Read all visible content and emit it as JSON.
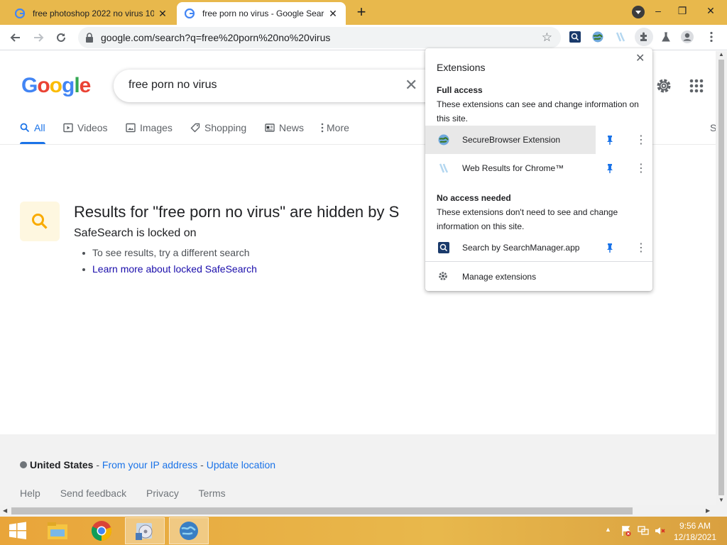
{
  "browser": {
    "tabs": [
      {
        "title": "free photoshop 2022 no virus 10",
        "active": false
      },
      {
        "title": "free porn no virus - Google Searc",
        "active": true
      }
    ],
    "url": "google.com/search?q=free%20porn%20no%20virus",
    "window_controls": {
      "minimize": "–",
      "restore": "❐",
      "close": "✕"
    },
    "toolbar_icons": [
      "back-icon",
      "forward-icon",
      "reload-icon",
      "lock-icon",
      "star-icon",
      "searchmanager-icon",
      "securebrowser-icon",
      "webresults-icon",
      "extensions-puzzle-icon",
      "lab-icon",
      "profile-icon",
      "menu-icon"
    ]
  },
  "google": {
    "logo": "Google",
    "query": "free porn no virus",
    "tabs": [
      {
        "label": "All",
        "icon": "search-icon",
        "selected": true
      },
      {
        "label": "Videos",
        "icon": "video-icon"
      },
      {
        "label": "Images",
        "icon": "image-icon"
      },
      {
        "label": "Shopping",
        "icon": "tag-icon"
      },
      {
        "label": "News",
        "icon": "news-icon"
      },
      {
        "label": "More",
        "icon": "kebab-icon"
      }
    ],
    "tools_partial": "S",
    "safesearch": {
      "title": "Results for \"free porn no virus\" are hidden by S",
      "subtitle": "SafeSearch is locked on",
      "bullets": [
        {
          "text": "To see results, try a different search",
          "link": false
        },
        {
          "text": "Learn more about locked SafeSearch",
          "link": true
        }
      ]
    },
    "footer": {
      "country": "United States",
      "sep1": " - ",
      "from_ip": "From your IP address",
      "sep2": " - ",
      "update": "Update location",
      "links": [
        "Help",
        "Send feedback",
        "Privacy",
        "Terms"
      ]
    }
  },
  "extensions_popup": {
    "title": "Extensions",
    "full_access": {
      "heading": "Full access",
      "description": "These extensions can see and change information on this site.",
      "items": [
        {
          "name": "SecureBrowser Extension",
          "icon": "securebrowser-icon",
          "pinned": true
        },
        {
          "name": "Web Results for Chrome™",
          "icon": "webresults-icon",
          "pinned": true
        }
      ]
    },
    "no_access": {
      "heading": "No access needed",
      "description": "These extensions don't need to see and change information on this site.",
      "items": [
        {
          "name": "Search by SearchManager.app",
          "icon": "searchmanager-icon",
          "pinned": true
        }
      ]
    },
    "manage": "Manage extensions"
  },
  "taskbar": {
    "apps": [
      "windows-start-icon",
      "file-explorer-icon",
      "chrome-icon",
      "installer-icon",
      "globe-app-icon"
    ],
    "time": "9:56 AM",
    "date": "12/18/2021"
  },
  "colors": {
    "tabbar": "#e8b84c",
    "accent": "#1a73e8",
    "link": "#1a0dab",
    "safesearch_bg": "#fef7e0",
    "safesearch_icon": "#f9ab00"
  }
}
